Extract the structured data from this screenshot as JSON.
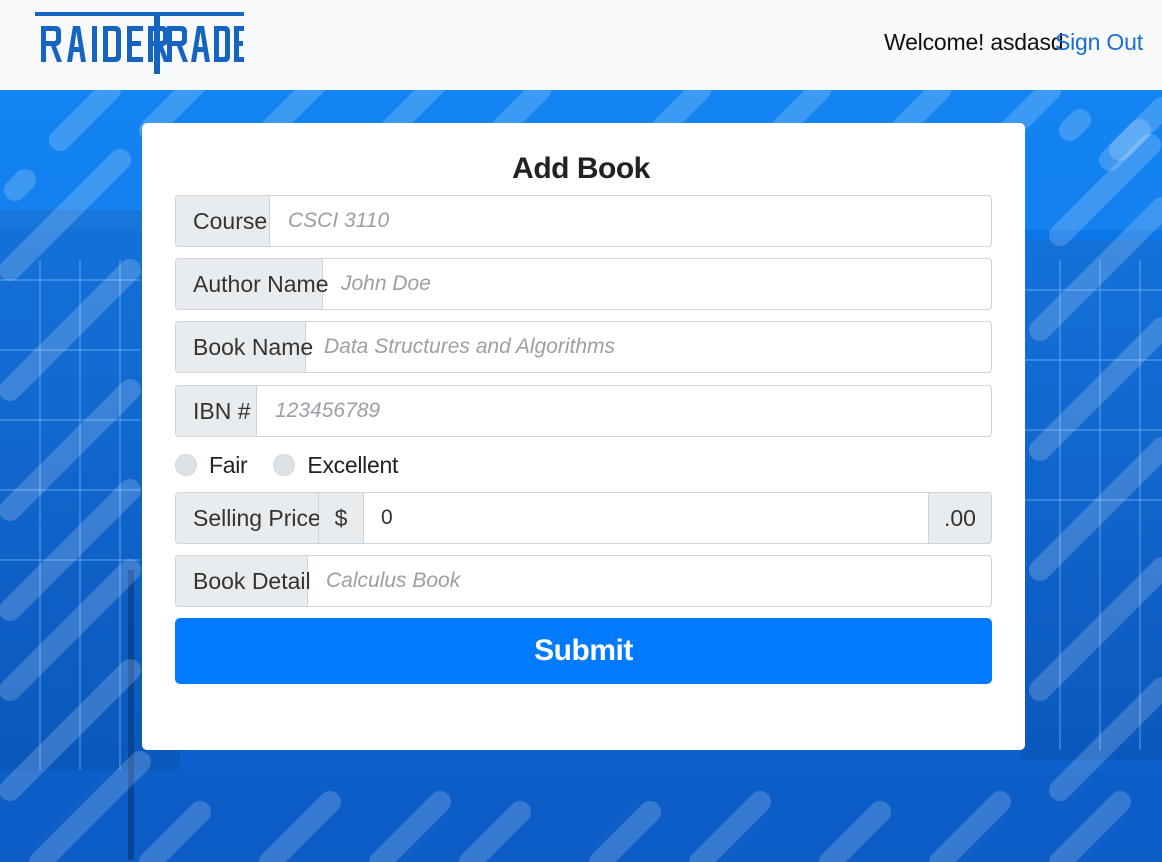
{
  "navbar": {
    "logo_text": "RAIDERTRADE",
    "welcome": "Welcome! asdasd",
    "signout": "Sign Out"
  },
  "form": {
    "title": "Add Book",
    "fields": [
      {
        "label": "Course",
        "placeholder": "CSCI 3110",
        "value": ""
      },
      {
        "label": "Author Name",
        "placeholder": "John Doe",
        "value": ""
      },
      {
        "label": "Book Name",
        "placeholder": "Data Structures and Algorithms",
        "value": ""
      },
      {
        "label": "IBN #",
        "placeholder": "123456789",
        "value": ""
      }
    ],
    "conditions": [
      "Fair",
      "Excellent"
    ],
    "price": {
      "label": "Selling Price",
      "currency": "$",
      "value": "0",
      "suffix": ".00"
    },
    "detail": {
      "label": "Book Detail",
      "placeholder": "Calculus Book",
      "value": ""
    },
    "submit": "Submit"
  },
  "colors": {
    "primary": "#007bff",
    "link": "#1a6fd6",
    "logo": "#1565c0",
    "addon_bg": "#e9ecef"
  }
}
